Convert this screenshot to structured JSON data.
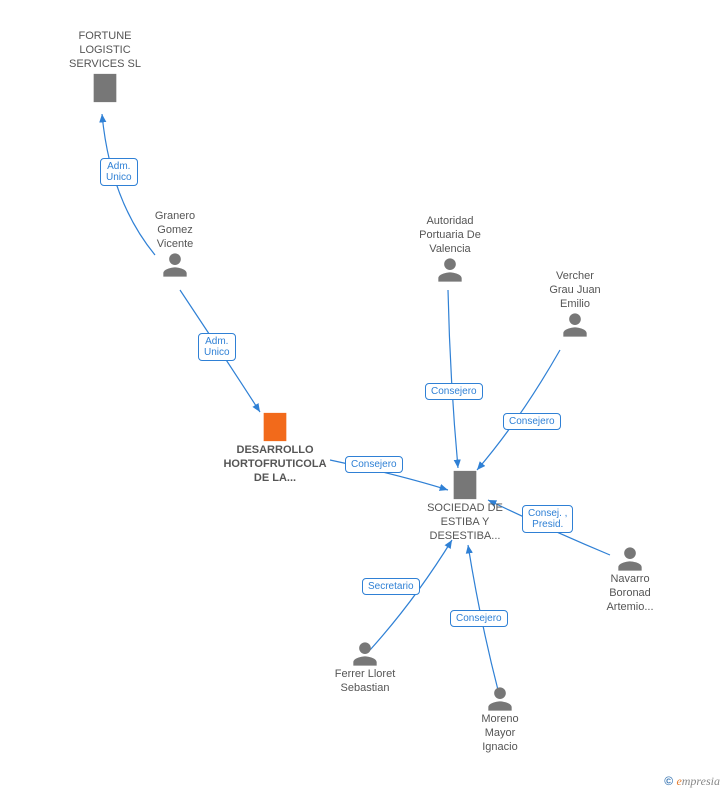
{
  "nodes": {
    "fortune": {
      "label": "FORTUNE\nLOGISTIC\nSERVICES SL"
    },
    "granero": {
      "label": "Granero\nGomez\nVicente"
    },
    "desarrollo": {
      "label": "DESARROLLO\nHORTOFRUTICOLA\nDE LA..."
    },
    "autoridad": {
      "label": "Autoridad\nPortuaria De\nValencia"
    },
    "vercher": {
      "label": "Vercher\nGrau Juan\nEmilio"
    },
    "sociedad": {
      "label": "SOCIEDAD DE\nESTIBA Y\nDESESTIBA..."
    },
    "navarro": {
      "label": "Navarro\nBoronad\nArtemio..."
    },
    "ferrer": {
      "label": "Ferrer Lloret\nSebastian"
    },
    "moreno": {
      "label": "Moreno\nMayor\nIgnacio"
    }
  },
  "edges": {
    "granero_fortune": {
      "label": "Adm.\nUnico"
    },
    "granero_desarrollo": {
      "label": "Adm.\nUnico"
    },
    "desarrollo_sociedad": {
      "label": "Consejero"
    },
    "autoridad_sociedad": {
      "label": "Consejero"
    },
    "vercher_sociedad": {
      "label": "Consejero"
    },
    "navarro_sociedad": {
      "label": "Consej. ,\nPresid."
    },
    "moreno_sociedad": {
      "label": "Consejero"
    },
    "ferrer_sociedad": {
      "label": "Secretario"
    }
  },
  "footer": {
    "copyright": "©",
    "brand_e": "e",
    "brand_rest": "mpresia"
  }
}
